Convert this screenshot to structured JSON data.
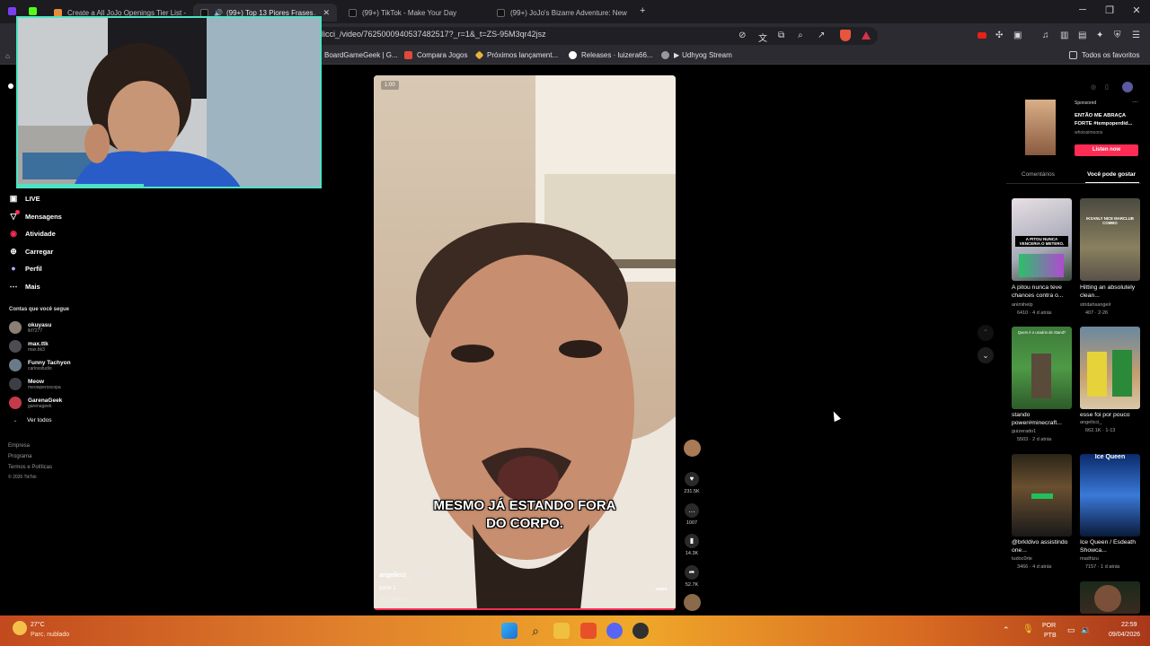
{
  "browser": {
    "tabs": [
      {
        "label": "Create a All JoJo Openings Tier List -"
      },
      {
        "label": "(99+) Top 13 Piores Frases Ap..."
      },
      {
        "label": "(99+) TikTok - Make Your Day"
      },
      {
        "label": "(99+) JoJo's Bizarre Adventure: New"
      }
    ],
    "url": "licci_/video/7625000940537482517?_r=1&_t=ZS-95M3qr42jsz",
    "bookmarks": [
      {
        "label": "BoardGameGeek | G..."
      },
      {
        "label": "Compara Jogos"
      },
      {
        "label": "Próximos lançament..."
      },
      {
        "label": "Releases · luizera66..."
      },
      {
        "label": "Udhyog Stream"
      }
    ],
    "all_bookmarks": "Todos os favoritos"
  },
  "sidebar": {
    "nav": [
      {
        "label": "LIVE",
        "icon": "live-icon"
      },
      {
        "label": "Mensagens",
        "icon": "messages-icon"
      },
      {
        "label": "Atividade",
        "icon": "activity-icon"
      },
      {
        "label": "Carregar",
        "icon": "upload-icon"
      },
      {
        "label": "Perfil",
        "icon": "profile-icon"
      },
      {
        "label": "Mais",
        "icon": "more-icon"
      }
    ],
    "following_title": "Contas que você segue",
    "following": [
      {
        "name": "okuyasu",
        "sub": "lkf7277"
      },
      {
        "name": "max.ttk",
        "sub": "max.ttk3"
      },
      {
        "name": "Funny Tachyon",
        "sub": "carlosstudio"
      },
      {
        "name": "Meow",
        "sub": "meowperoscopa"
      },
      {
        "name": "GarenaGeek",
        "sub": "garenageek"
      }
    ],
    "see_all": "Ver todos",
    "footer": [
      "Empresa",
      "Programa",
      "Termos e Políticas",
      "© 2026 TikTok"
    ]
  },
  "video": {
    "caption_line1": "MESMO JÁ ESTANDO FORA",
    "caption_line2": "DO CORPO.",
    "time_badge": "1:00",
    "author": "angelicci_",
    "posted": "· 5 d atrás",
    "desc": "parte 2",
    "translate": "Ver tradução",
    "more": "mais",
    "likes": "231.5K",
    "comments": "1007",
    "saves": "14.3K",
    "shares": "52.7K"
  },
  "right": {
    "ad": {
      "sponsored": "Sponsored",
      "title": "ENTÃO ME ABRAÇA FORTE #tempoperdid...",
      "author": "whoissimoons",
      "cta": "Listen now"
    },
    "tabs": [
      "Comentários",
      "Você pode gostar"
    ],
    "cards": [
      {
        "title": "A pitou nunca teve chances contra o...",
        "author": "animihelp",
        "stats": "6410 · 4 d atrás",
        "thumb_text": "A PITOU NUNCA VENCERIA O METERO."
      },
      {
        "title": "Hitting an absolutely clean...",
        "author": "stridahsangelr",
        "stats": "407 · 2-26",
        "thumb_text": "IKSANLY NICE MARCLUB COMBO"
      },
      {
        "title": "stando power#minecraft...",
        "author": "guizerado1",
        "stats": "5503 · 2 d atrás",
        "thumb_text": "Quem é o usuário de Stand?"
      },
      {
        "title": "esse foi por pouco",
        "author": "angelicci_",
        "stats": "662.1K · 1-13",
        "thumb_text": ""
      },
      {
        "title": "@brkldivo assistindo one...",
        "author": "tudoc0rte",
        "stats": "3466 · 4 d atrás",
        "thumb_text": ""
      },
      {
        "title": "Ice Queen / Esdeath Showca...",
        "author": "madhizu",
        "stats": "7157 · 1 d atrás",
        "thumb_text": "Ice Queen"
      }
    ]
  },
  "taskbar": {
    "weather_temp": "27°C",
    "weather_desc": "Parc. nublado",
    "lang1": "POR",
    "lang2": "PTB",
    "time": "22:59",
    "date": "09/04/2026"
  }
}
